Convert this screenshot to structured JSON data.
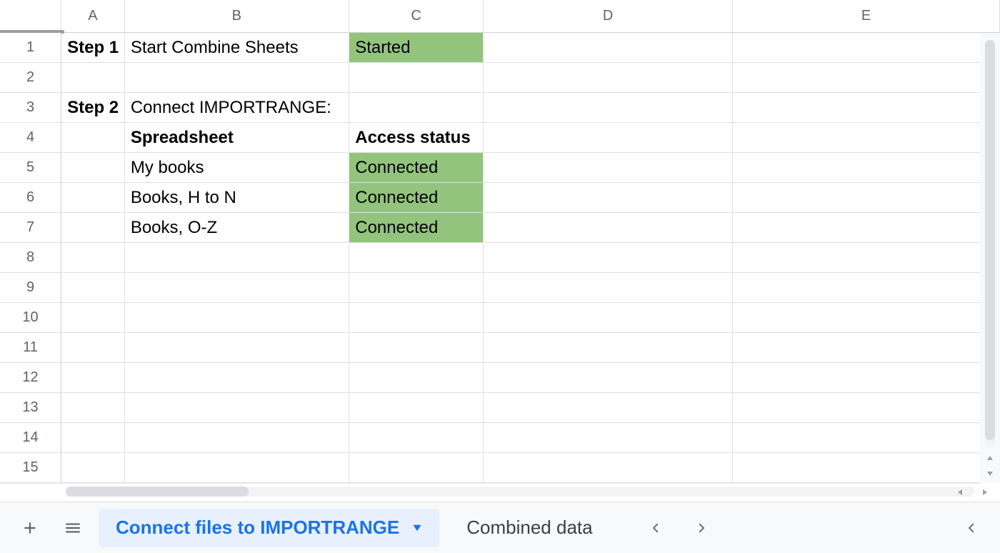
{
  "columns": [
    "A",
    "B",
    "C",
    "D",
    "E"
  ],
  "rows": [
    "1",
    "2",
    "3",
    "4",
    "5",
    "6",
    "7",
    "8",
    "9",
    "10",
    "11",
    "12",
    "13",
    "14",
    "15"
  ],
  "cells": {
    "r1": {
      "a": "Step 1",
      "b": "Start Combine Sheets",
      "c": "Started"
    },
    "r3": {
      "a": "Step 2",
      "b": "Connect IMPORTRANGE:"
    },
    "r4": {
      "b": "Spreadsheet",
      "c": "Access status"
    },
    "r5": {
      "b": "My books",
      "c": "Connected"
    },
    "r6": {
      "b": "Books, H to N",
      "c": "Connected"
    },
    "r7": {
      "b": "Books, O-Z",
      "c": "Connected"
    }
  },
  "tabs": {
    "active": "Connect files to IMPORTRANGE",
    "other": "Combined data"
  }
}
